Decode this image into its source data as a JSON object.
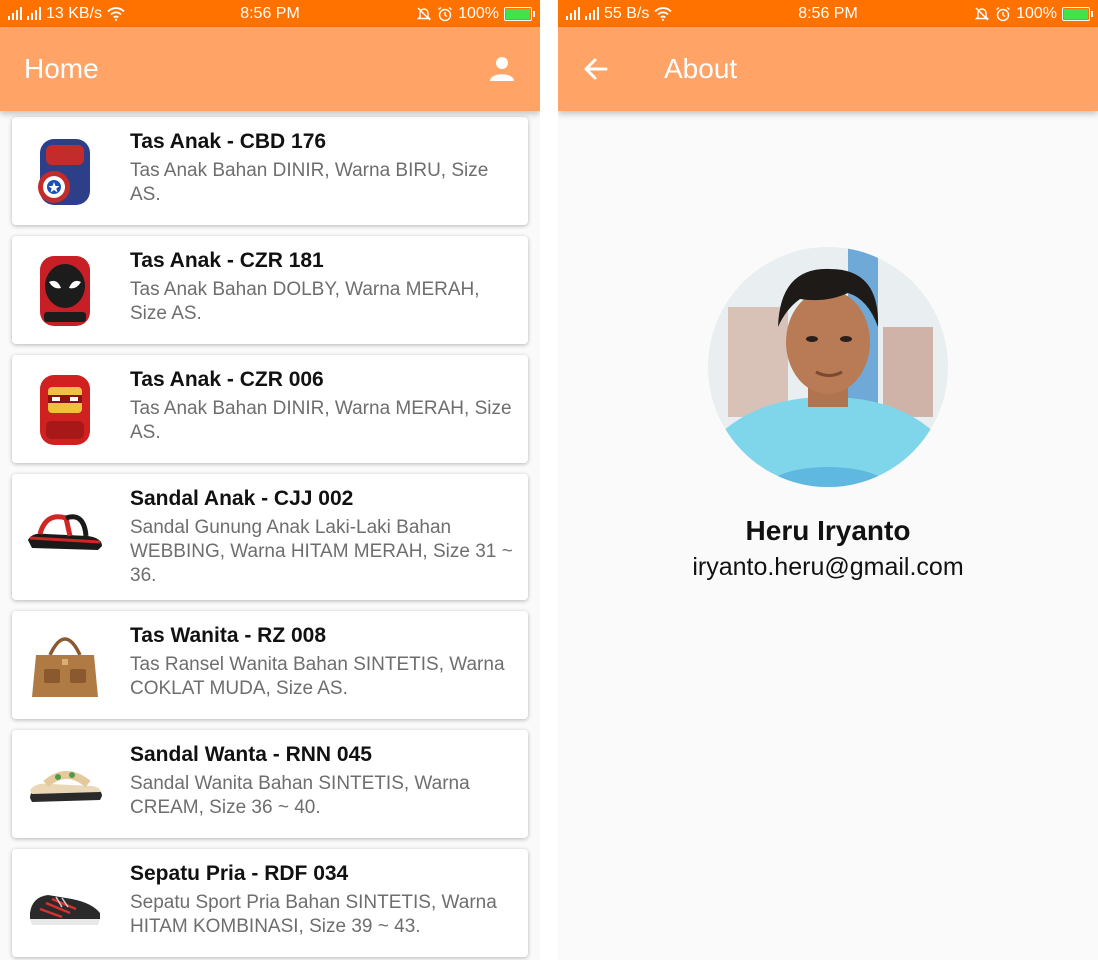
{
  "left": {
    "status": {
      "speed": "13 KB/s",
      "time": "8:56 PM",
      "battery": "100%"
    },
    "app_bar": {
      "title": "Home",
      "account_icon": "account-icon"
    },
    "products": [
      {
        "name": "Tas Anak - CBD 176",
        "desc": "Tas Anak Bahan DINIR, Warna BIRU, Size AS.",
        "image": "blue-backpack"
      },
      {
        "name": "Tas Anak - CZR 181",
        "desc": "Tas Anak Bahan DOLBY, Warna MERAH, Size AS.",
        "image": "spiderman-backpack"
      },
      {
        "name": "Tas Anak - CZR 006",
        "desc": "Tas Anak Bahan DINIR, Warna MERAH, Size AS.",
        "image": "red-backpack"
      },
      {
        "name": "Sandal Anak - CJJ 002",
        "desc": "Sandal Gunung Anak Laki-Laki Bahan WEBBING, Warna HITAM MERAH, Size 31 ~ 36.",
        "image": "black-red-sandal"
      },
      {
        "name": "Tas Wanita - RZ 008",
        "desc": "Tas Ransel Wanita Bahan SINTETIS, Warna COKLAT MUDA, Size AS.",
        "image": "brown-handbag"
      },
      {
        "name": "Sandal Wanta - RNN 045",
        "desc": "Sandal Wanita Bahan SINTETIS, Warna CREAM, Size 36 ~ 40.",
        "image": "cream-sandal"
      },
      {
        "name": "Sepatu Pria - RDF 034",
        "desc": "Sepatu Sport Pria Bahan SINTETIS, Warna HITAM KOMBINASI, Size 39 ~ 43.",
        "image": "sport-shoe"
      }
    ]
  },
  "right": {
    "status": {
      "speed": "55 B/s",
      "time": "8:56 PM",
      "battery": "100%"
    },
    "app_bar": {
      "title": "About",
      "back_icon": "back-arrow-icon"
    },
    "profile": {
      "name": "Heru Iryanto",
      "email": "iryanto.heru@gmail.com"
    }
  },
  "colors": {
    "status_bar": "#ff7200",
    "app_bar": "#ffa366",
    "background": "#fafafa",
    "battery_fill": "#45e04a"
  }
}
